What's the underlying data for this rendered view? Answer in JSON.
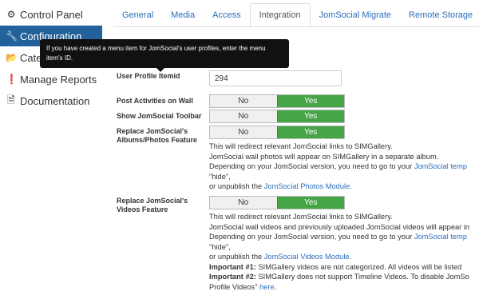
{
  "sidebar": {
    "items": [
      {
        "icon": "gear-icon",
        "glyph": "⚙",
        "label": "Control Panel"
      },
      {
        "icon": "wrench-icon",
        "glyph": "🔧",
        "label": "Configuration"
      },
      {
        "icon": "folder-icon",
        "glyph": "📂",
        "label": "Categ"
      },
      {
        "icon": "info-circle-icon",
        "glyph": "❗",
        "label": "Manage Reports"
      },
      {
        "icon": "document-icon",
        "glyph": "🗎",
        "label": "Documentation"
      }
    ]
  },
  "tabs": [
    {
      "label": "General"
    },
    {
      "label": "Media"
    },
    {
      "label": "Access"
    },
    {
      "label": "Integration"
    },
    {
      "label": "JomSocial Migrate"
    },
    {
      "label": "Remote Storage"
    }
  ],
  "tooltip": {
    "text": "If you have created a menu item for JomSocial's user profiles, enter the menu item's ID."
  },
  "form": {
    "itemid": {
      "label": "User Profile Itemid",
      "value": "294"
    },
    "post_activities": {
      "label": "Post Activities on Wall",
      "no": "No",
      "yes": "Yes"
    },
    "show_toolbar": {
      "label": "Show JomSocial Toolbar",
      "no": "No",
      "yes": "Yes"
    },
    "replace_albums": {
      "label": "Replace JomSocial's Albums/Photos Feature",
      "no": "No",
      "yes": "Yes",
      "desc": {
        "l1": "This will redirect relevant JomSocial links to SIMGallery.",
        "l2": "JomSocial wall photos will appear on SIMGallery in a separate album.",
        "l3a": "Depending on your JomSocial version, you need to go to your ",
        "l3link": "JomSocial temp",
        "l4": "\"hide\",",
        "l5a": "or unpublish the ",
        "l5link": "JomSocial Photos Module",
        "l5b": "."
      }
    },
    "replace_videos": {
      "label": "Replace JomSocial's Videos Feature",
      "no": "No",
      "yes": "Yes",
      "desc": {
        "l1": "This will redirect relevant JomSocial links to SIMGallery.",
        "l2": "JomSocial wall videos and previously uploaded JomSocial videos will appear in",
        "l3a": "Depending on your JomSocial version, you need to go to your ",
        "l3link": "JomSocial temp",
        "l4": "\"hide\",",
        "l5a": "or unpublish the ",
        "l5link": "JomSocial Videos Module",
        "l5b": ".",
        "imp1_label": "Important #1:",
        "imp1_text": " SIMGallery videos are not categorized. All videos will be listed",
        "imp2_label": "Important #2:",
        "imp2_text": " SIMGallery does not support Timeline Videos. To disable JomSo",
        "l8a": "Profile Videos\" ",
        "l8link": "here",
        "l8b": "."
      }
    }
  },
  "colors": {
    "active_sidebar": "#226199",
    "toggle_yes": "#46a546",
    "link": "#2a6ebb"
  }
}
